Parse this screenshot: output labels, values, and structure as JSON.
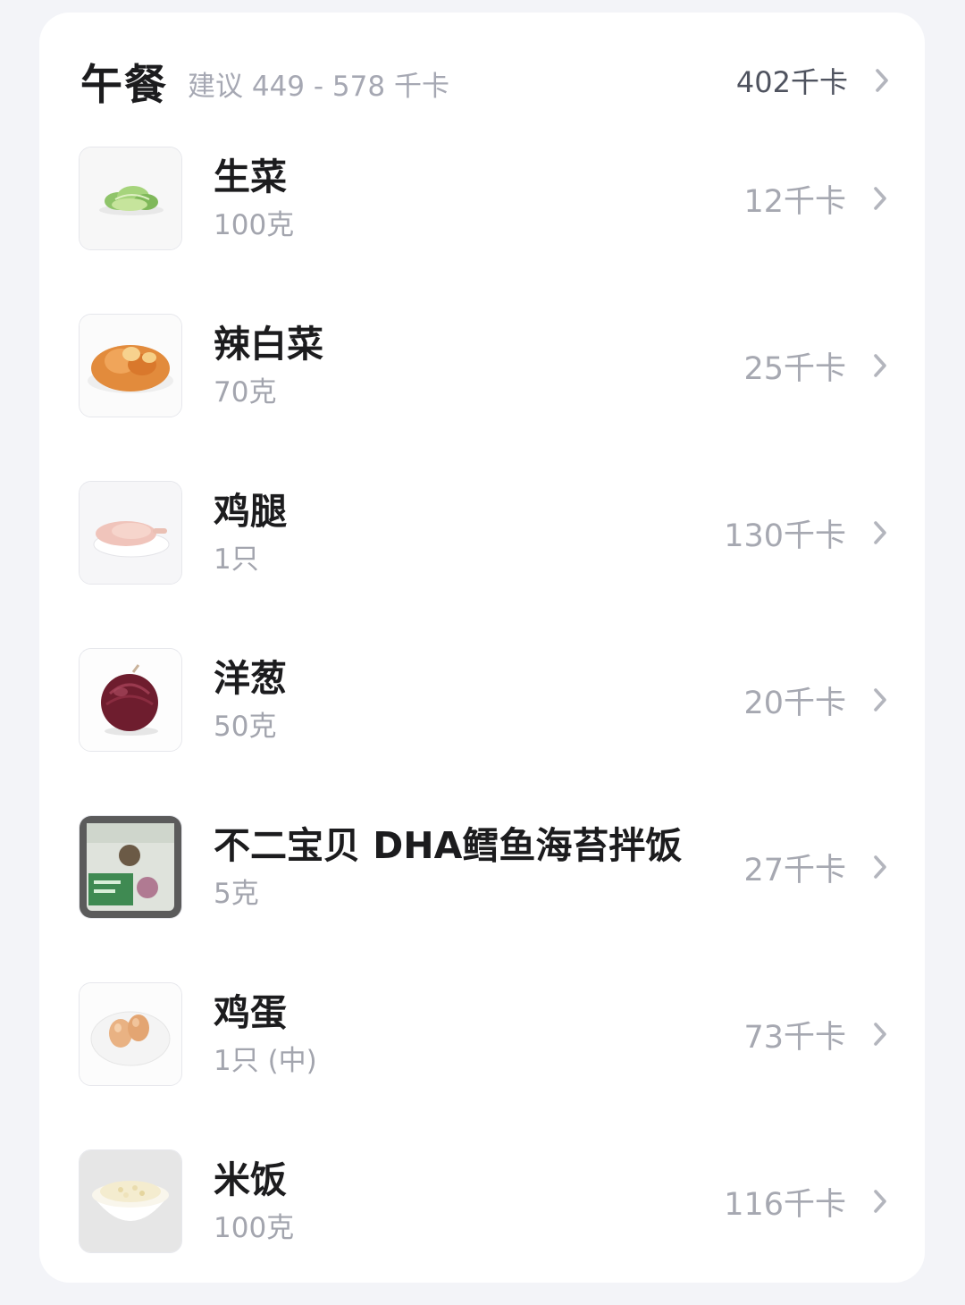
{
  "meal": {
    "title": "午餐",
    "suggestion": "建议 449 - 578 千卡",
    "total": "402千卡"
  },
  "items": [
    {
      "name": "生菜",
      "amount": "100克",
      "kcal": "12千卡",
      "thumb_icon": "lettuce-icon"
    },
    {
      "name": "辣白菜",
      "amount": "70克",
      "kcal": "25千卡",
      "thumb_icon": "kimchi-icon"
    },
    {
      "name": "鸡腿",
      "amount": "1只",
      "kcal": "130千卡",
      "thumb_icon": "chicken-leg-icon"
    },
    {
      "name": "洋葱",
      "amount": "50克",
      "kcal": "20千卡",
      "thumb_icon": "onion-icon"
    },
    {
      "name": "不二宝贝 DHA鳕鱼海苔拌饭",
      "amount": "5克",
      "kcal": "27千卡",
      "thumb_icon": "seasoning-package-icon"
    },
    {
      "name": "鸡蛋",
      "amount": "1只 (中)",
      "kcal": "73千卡",
      "thumb_icon": "eggs-icon"
    },
    {
      "name": "米饭",
      "amount": "100克",
      "kcal": "116千卡",
      "thumb_icon": "rice-bowl-icon"
    }
  ],
  "colors": {
    "background": "#f3f4f8",
    "card": "#ffffff",
    "title": "#1c1c1e",
    "muted": "#a6a8b1"
  }
}
